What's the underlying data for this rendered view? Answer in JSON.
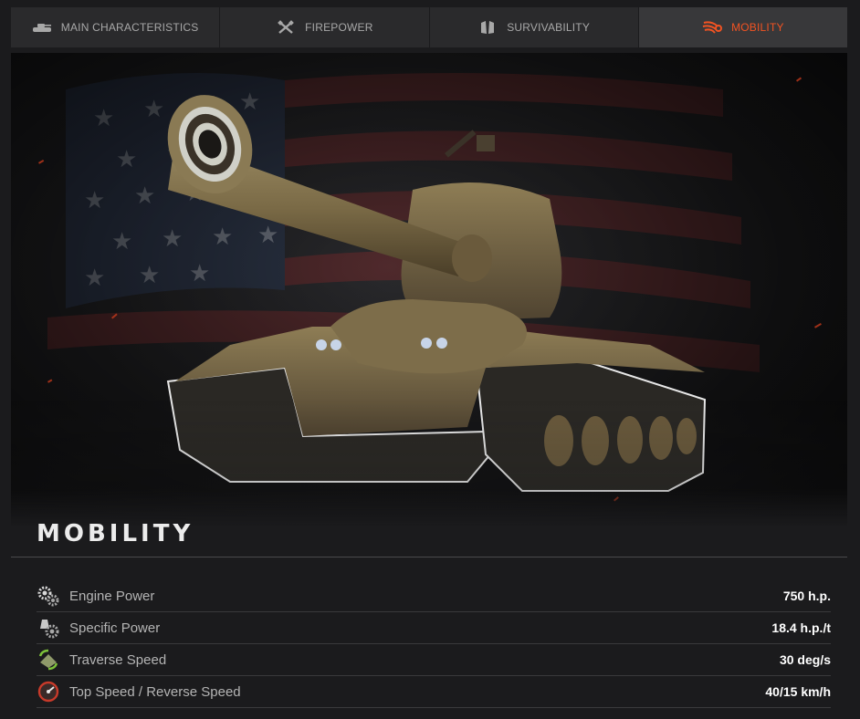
{
  "tabs": [
    {
      "label": "MAIN CHARACTERISTICS",
      "icon": "tank-icon",
      "active": false
    },
    {
      "label": "FIREPOWER",
      "icon": "crossed-guns-icon",
      "active": false
    },
    {
      "label": "SURVIVABILITY",
      "icon": "armor-plates-icon",
      "active": false
    },
    {
      "label": "MOBILITY",
      "icon": "speed-wings-icon",
      "active": true
    }
  ],
  "section": {
    "title": "MOBILITY"
  },
  "stats": [
    {
      "label": "Engine Power",
      "value": "750 h.p.",
      "icon": "gears-icon"
    },
    {
      "label": "Specific Power",
      "value": "18.4 h.p./t",
      "icon": "weight-gear-icon"
    },
    {
      "label": "Traverse Speed",
      "value": "30 deg/s",
      "icon": "traverse-arrows-icon"
    },
    {
      "label": "Top Speed / Reverse Speed",
      "value": "40/15 km/h",
      "icon": "speedometer-icon"
    }
  ],
  "colors": {
    "accent": "#f25322",
    "background": "#1b1b1d",
    "tab_bg": "#2a2a2c",
    "tab_active_bg": "#38383a"
  }
}
